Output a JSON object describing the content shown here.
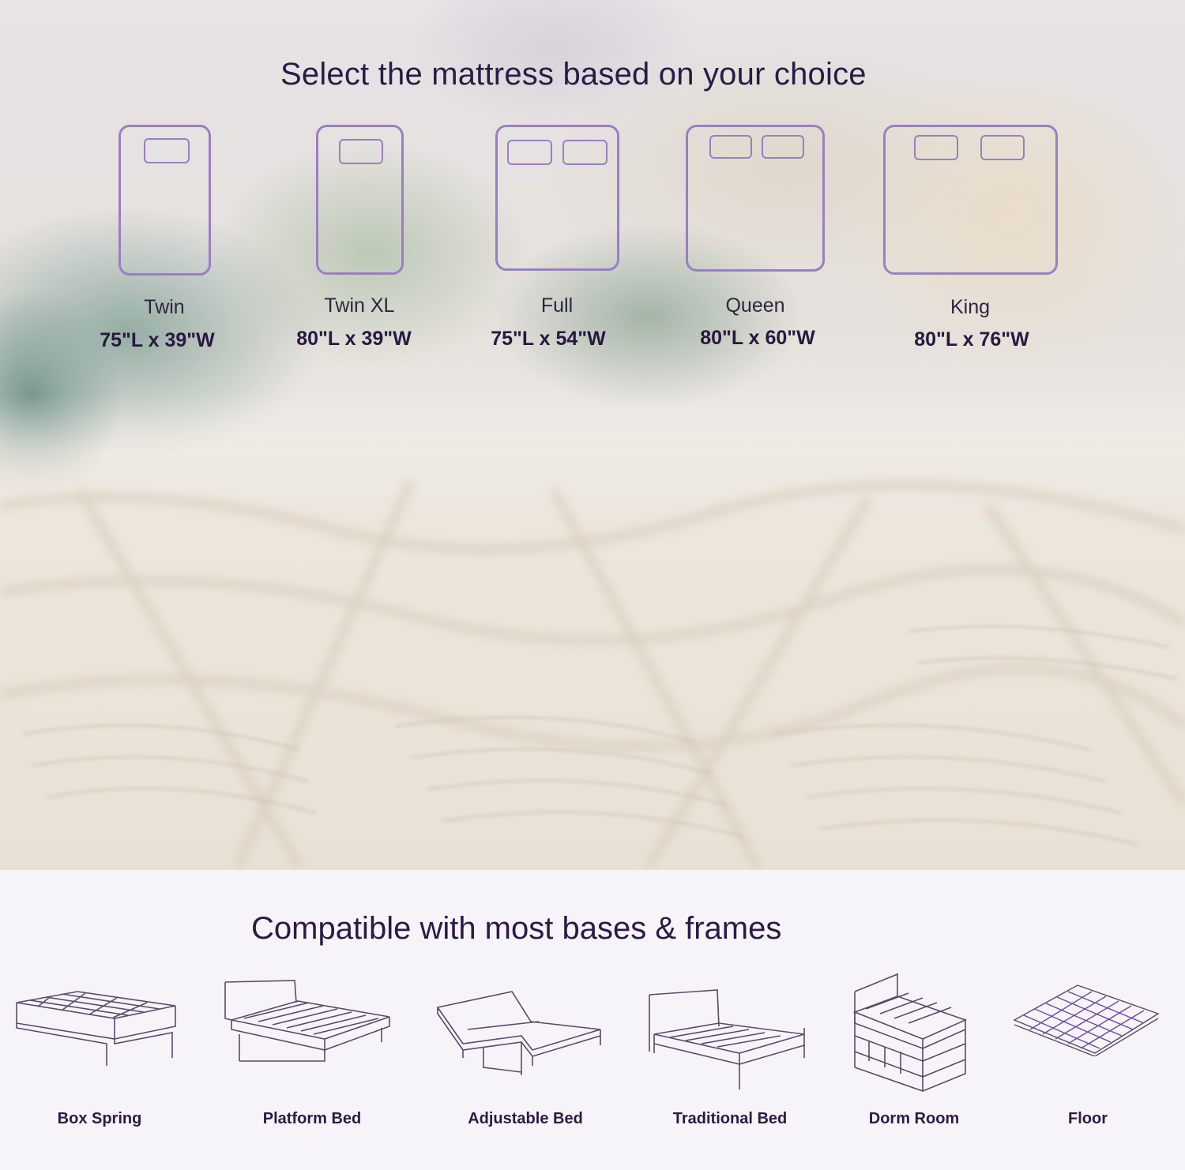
{
  "sizes_section": {
    "title": "Select the mattress based on your choice",
    "sizes": [
      {
        "name": "Twin",
        "dimensions": "75\"L x 39\"W",
        "icon": "twin-bed-icon"
      },
      {
        "name": "Twin XL",
        "dimensions": "80\"L x 39\"W",
        "icon": "twin-xl-bed-icon"
      },
      {
        "name": "Full",
        "dimensions": "75\"L x 54\"W",
        "icon": "full-bed-icon"
      },
      {
        "name": "Queen",
        "dimensions": "80\"L x 60\"W",
        "icon": "queen-bed-icon"
      },
      {
        "name": "King",
        "dimensions": "80\"L x 76\"W",
        "icon": "king-bed-icon"
      }
    ]
  },
  "bases_section": {
    "title": "Compatible with most bases & frames",
    "bases": [
      {
        "label": "Box Spring",
        "icon": "box-spring-icon"
      },
      {
        "label": "Platform Bed",
        "icon": "platform-bed-icon"
      },
      {
        "label": "Adjustable Bed",
        "icon": "adjustable-bed-icon"
      },
      {
        "label": "Traditional Bed",
        "icon": "traditional-bed-icon"
      },
      {
        "label": "Dorm Room",
        "icon": "dorm-room-icon"
      },
      {
        "label": "Floor",
        "icon": "floor-icon"
      }
    ]
  },
  "colors": {
    "accent_purple": "#9b7ec2",
    "heading_text": "#2a1b45",
    "line_art": "#5a4a6a",
    "floor_pattern": "#6d4aa0"
  }
}
